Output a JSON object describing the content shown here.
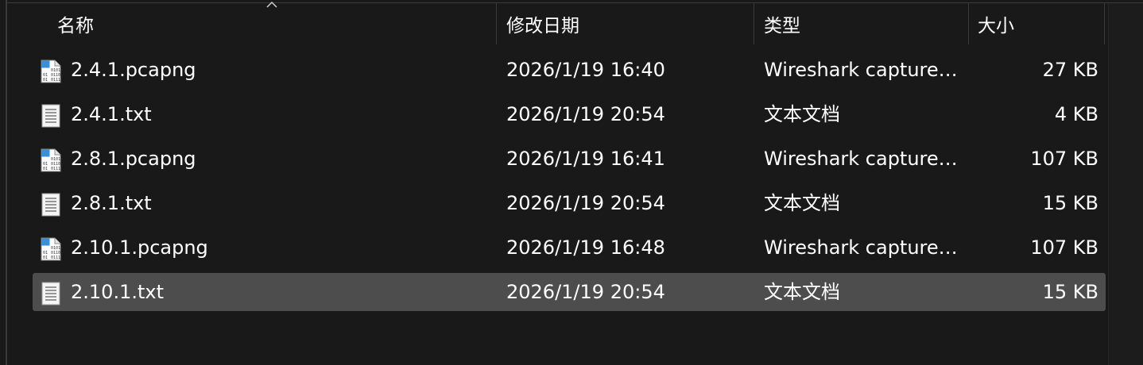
{
  "header": {
    "col_name": "名称",
    "col_date": "修改日期",
    "col_type": "类型",
    "col_size": "大小",
    "sort_indicator_icon": "chevron-up-icon"
  },
  "files": [
    {
      "name": "2.4.1.pcapng",
      "date": "2026/1/19 16:40",
      "type": "Wireshark capture f...",
      "size": "27 KB",
      "icon": "pcapng-file-icon",
      "selected": false
    },
    {
      "name": "2.4.1.txt",
      "date": "2026/1/19 20:54",
      "type": "文本文档",
      "size": "4 KB",
      "icon": "text-file-icon",
      "selected": false
    },
    {
      "name": "2.8.1.pcapng",
      "date": "2026/1/19 16:41",
      "type": "Wireshark capture f...",
      "size": "107 KB",
      "icon": "pcapng-file-icon",
      "selected": false
    },
    {
      "name": "2.8.1.txt",
      "date": "2026/1/19 20:54",
      "type": "文本文档",
      "size": "15 KB",
      "icon": "text-file-icon",
      "selected": false
    },
    {
      "name": "2.10.1.pcapng",
      "date": "2026/1/19 16:48",
      "type": "Wireshark capture f...",
      "size": "107 KB",
      "icon": "pcapng-file-icon",
      "selected": false
    },
    {
      "name": "2.10.1.txt",
      "date": "2026/1/19 20:54",
      "type": "文本文档",
      "size": "15 KB",
      "icon": "text-file-icon",
      "selected": true
    }
  ],
  "colors": {
    "background": "#191919",
    "selected_row": "#4d4d4d",
    "text": "#ffffff"
  }
}
